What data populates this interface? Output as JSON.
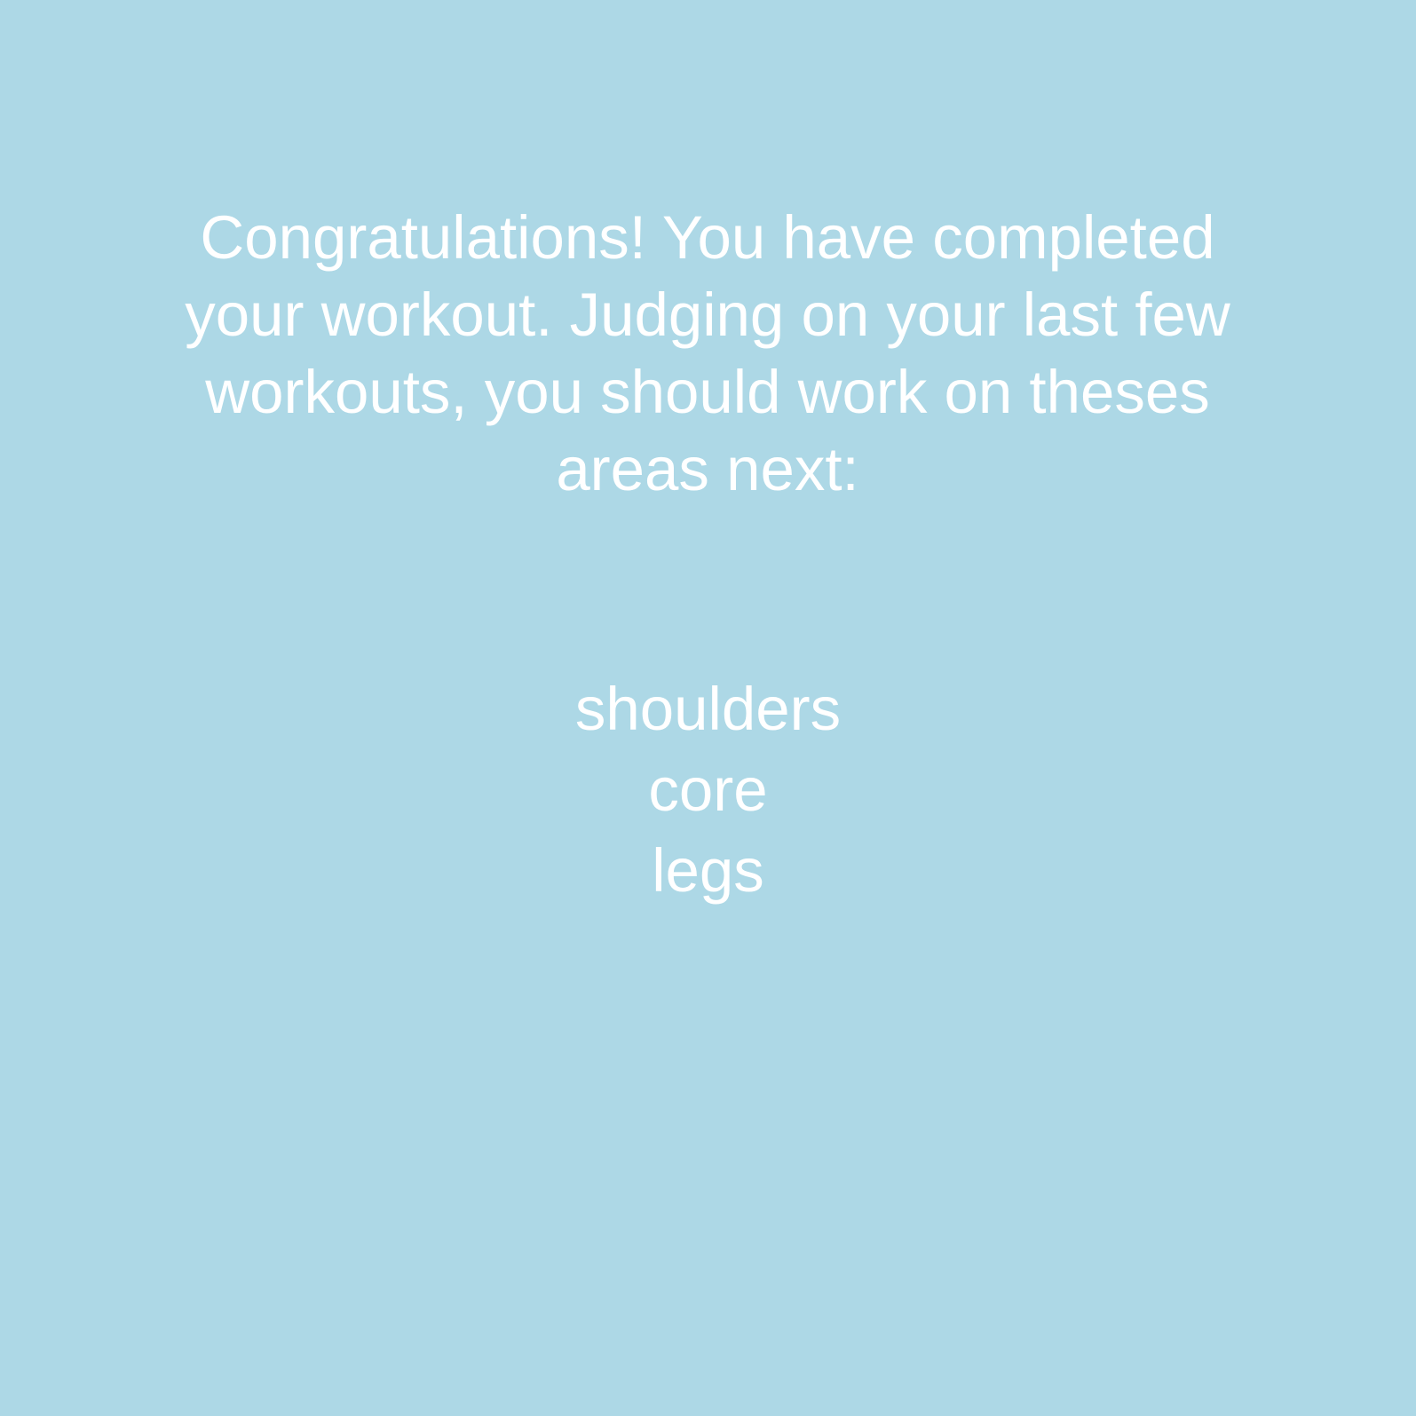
{
  "screen": {
    "background_color": "#add8e6",
    "text_color": "#ffffff",
    "message": "Congratulations! You have completed your workout. Judging on your last few workouts, you should work on theses areas next:",
    "areas": [
      "shoulders",
      "core",
      "legs"
    ]
  }
}
